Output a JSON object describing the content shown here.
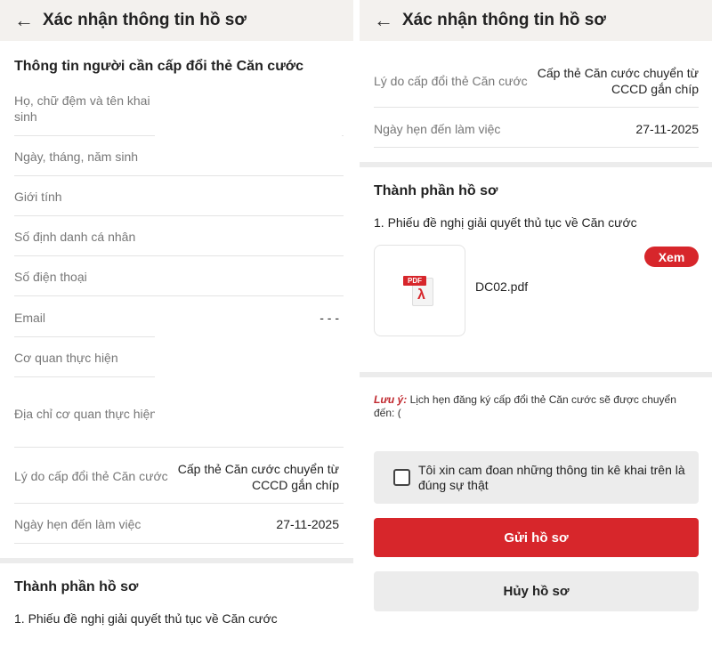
{
  "header": {
    "title": "Xác nhận thông tin hồ sơ",
    "back_icon": "arrow-left-icon"
  },
  "left": {
    "section_title": "Thông tin người cần cấp đổi thẻ Căn cước",
    "fields": {
      "full_name": {
        "label": "Họ, chữ đệm và tên khai sinh"
      },
      "dob": {
        "label": "Ngày, tháng, năm sinh"
      },
      "gender": {
        "label": "Giới tính"
      },
      "id_number": {
        "label": "Số định danh cá nhân"
      },
      "phone": {
        "label": "Số điện thoại"
      },
      "email": {
        "label": "Email",
        "value": "- - -"
      },
      "agency": {
        "label": "Cơ quan thực hiện"
      },
      "agency_address": {
        "label": "Địa chỉ cơ quan thực hiện"
      },
      "reason": {
        "label": "Lý do cấp đổi thẻ Căn cước",
        "value": "Cấp thẻ Căn cước chuyển từ CCCD gắn chíp"
      },
      "appointment": {
        "label": "Ngày hẹn đến làm việc",
        "value": "27-11-2025"
      }
    },
    "docs_title": "Thành phần hồ sơ",
    "doc_item": "1. Phiếu đề nghị giải quyết thủ tục về Căn cước"
  },
  "right": {
    "reason": {
      "label": "Lý do cấp đổi thẻ Căn cước",
      "value": "Cấp thẻ Căn cước chuyển từ CCCD gắn chíp"
    },
    "appointment": {
      "label": "Ngày hẹn đến làm việc",
      "value": "27-11-2025"
    },
    "docs_title": "Thành phần hồ sơ",
    "doc_item": "1. Phiếu đề nghị giải quyết thủ tục về Căn cước",
    "file": {
      "name": "DC02.pdf",
      "badge": "PDF",
      "icon": "pdf-file-icon",
      "view_label": "Xem"
    },
    "note_prefix": "Lưu ý:",
    "note_text": "Lịch hẹn đăng ký cấp đổi thẻ Căn cước sẽ được chuyển đến: (",
    "commit_text": "Tôi xin cam đoan những thông tin kê khai trên là đúng sự thật",
    "submit_label": "Gửi hồ sơ",
    "cancel_label": "Hủy hồ sơ"
  },
  "colors": {
    "accent": "#d7262b",
    "header_bg": "#f3f1ee",
    "cancel_bg": "#ececec",
    "note": "#c0282e"
  }
}
